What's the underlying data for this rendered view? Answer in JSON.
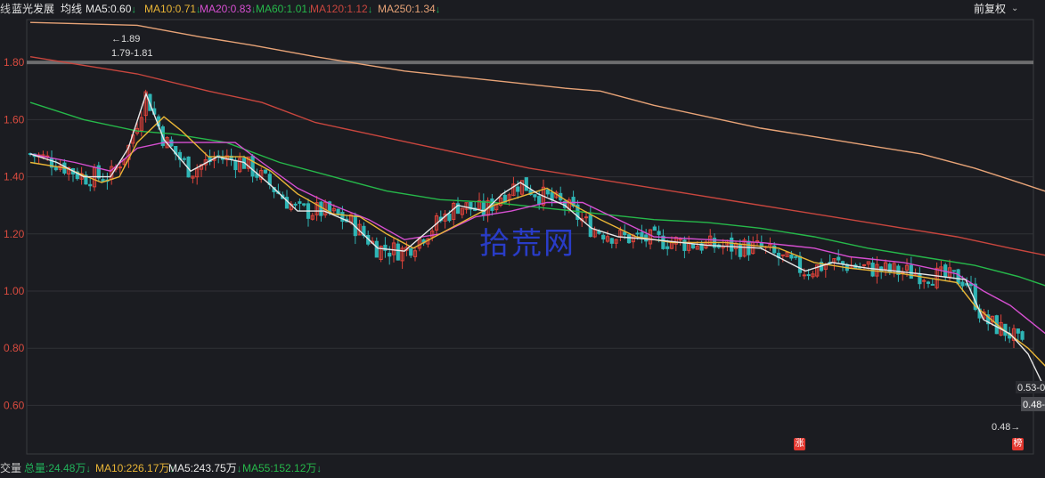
{
  "header": {
    "left_cut": "线",
    "stock_name": "蓝光发展",
    "mode": "均线",
    "ma_values": [
      {
        "label": "MA5:0.60",
        "color": "#e8e8e8"
      },
      {
        "label": "MA10:0.71",
        "color": "#e9b536"
      },
      {
        "label": "MA20:0.83",
        "color": "#d64fd1"
      },
      {
        "label": "MA60:1.01",
        "color": "#26b84a"
      },
      {
        "label": "MA120:1.12",
        "color": "#c8463e"
      },
      {
        "label": "MA250:1.34",
        "color": "#e7a377"
      }
    ],
    "down_arrow": "↓",
    "adjust_label": "前复权"
  },
  "volume_bar": {
    "left_cut": "交量",
    "items": [
      {
        "label": "总量:24.48万",
        "color": "#21b35b"
      },
      {
        "label": "MA10:226.17万",
        "color": "#e9b536"
      },
      {
        "label": "MA5:243.75万",
        "color": "#e8e8e8"
      },
      {
        "label": "MA55:152.12万",
        "color": "#26b84a"
      }
    ]
  },
  "watermark": "拾荒网",
  "badges": {
    "limit_up": "涨",
    "rank": "榜"
  },
  "chart_data": {
    "type": "line",
    "ylim": [
      0.43,
      1.95
    ],
    "y_ticks": [
      "0.60",
      "0.80",
      "1.00",
      "1.20",
      "1.40",
      "1.60",
      "1.80"
    ],
    "grid": true,
    "reference_line": 1.8,
    "annotations": {
      "high_mark": "1.89",
      "high_range": "1.79-1.81",
      "last_range": "0.53-0",
      "last_price_tag": "0.48-",
      "low_mark": "0.48"
    },
    "series": [
      {
        "name": "MA250",
        "color": "#e7a377",
        "x": [
          0,
          120,
          190,
          250,
          320,
          380,
          420,
          480,
          540,
          600,
          640,
          700,
          760,
          820,
          880,
          940,
          1000,
          1060,
          1100,
          1148
        ],
        "y": [
          1.94,
          1.93,
          1.89,
          1.86,
          1.82,
          1.79,
          1.77,
          1.75,
          1.73,
          1.71,
          1.7,
          1.65,
          1.61,
          1.57,
          1.54,
          1.51,
          1.48,
          1.43,
          1.39,
          1.34
        ]
      },
      {
        "name": "MA120",
        "color": "#c8463e",
        "x": [
          0,
          60,
          120,
          200,
          260,
          320,
          380,
          440,
          500,
          560,
          620,
          680,
          740,
          800,
          860,
          920,
          980,
          1040,
          1100,
          1148
        ],
        "y": [
          1.82,
          1.79,
          1.76,
          1.7,
          1.66,
          1.59,
          1.55,
          1.51,
          1.47,
          1.43,
          1.4,
          1.37,
          1.34,
          1.31,
          1.28,
          1.25,
          1.22,
          1.19,
          1.15,
          1.12
        ]
      },
      {
        "name": "MA60",
        "color": "#26b84a",
        "x": [
          0,
          60,
          120,
          160,
          220,
          280,
          340,
          400,
          460,
          520,
          580,
          640,
          700,
          760,
          820,
          880,
          940,
          1000,
          1060,
          1110,
          1148
        ],
        "y": [
          1.66,
          1.6,
          1.56,
          1.55,
          1.52,
          1.45,
          1.4,
          1.35,
          1.32,
          1.31,
          1.29,
          1.27,
          1.25,
          1.24,
          1.22,
          1.19,
          1.15,
          1.12,
          1.09,
          1.05,
          1.01
        ]
      },
      {
        "name": "MA20",
        "color": "#d64fd1",
        "x": [
          0,
          50,
          90,
          120,
          150,
          190,
          230,
          260,
          300,
          340,
          380,
          420,
          460,
          500,
          540,
          580,
          620,
          660,
          700,
          760,
          820,
          880,
          920,
          980,
          1040,
          1070,
          1100,
          1148
        ],
        "y": [
          1.48,
          1.45,
          1.42,
          1.5,
          1.52,
          1.52,
          1.52,
          1.45,
          1.36,
          1.3,
          1.25,
          1.18,
          1.2,
          1.26,
          1.28,
          1.31,
          1.31,
          1.25,
          1.19,
          1.18,
          1.17,
          1.15,
          1.12,
          1.1,
          1.06,
          1.0,
          0.95,
          0.83
        ]
      },
      {
        "name": "MA10",
        "color": "#e9b536",
        "x": [
          0,
          40,
          80,
          100,
          120,
          150,
          170,
          200,
          240,
          270,
          300,
          340,
          370,
          400,
          430,
          460,
          490,
          520,
          550,
          580,
          610,
          640,
          680,
          720,
          780,
          840,
          880,
          920,
          980,
          1040,
          1060,
          1090,
          1120,
          1148
        ],
        "y": [
          1.45,
          1.43,
          1.38,
          1.4,
          1.52,
          1.61,
          1.56,
          1.47,
          1.47,
          1.42,
          1.34,
          1.27,
          1.26,
          1.2,
          1.15,
          1.2,
          1.25,
          1.3,
          1.33,
          1.36,
          1.3,
          1.25,
          1.19,
          1.17,
          1.17,
          1.15,
          1.1,
          1.08,
          1.06,
          1.03,
          0.95,
          0.87,
          0.8,
          0.71
        ]
      },
      {
        "name": "MA5",
        "color": "#e8e8e8",
        "x": [
          0,
          30,
          60,
          90,
          110,
          130,
          150,
          180,
          210,
          240,
          270,
          300,
          330,
          360,
          390,
          420,
          450,
          480,
          510,
          530,
          550,
          570,
          600,
          630,
          660,
          700,
          760,
          820,
          870,
          900,
          940,
          1000,
          1050,
          1070,
          1100,
          1120,
          1148
        ],
        "y": [
          1.48,
          1.45,
          1.4,
          1.4,
          1.5,
          1.69,
          1.53,
          1.42,
          1.47,
          1.45,
          1.37,
          1.28,
          1.28,
          1.24,
          1.15,
          1.14,
          1.22,
          1.3,
          1.28,
          1.34,
          1.38,
          1.34,
          1.3,
          1.22,
          1.19,
          1.18,
          1.16,
          1.15,
          1.07,
          1.1,
          1.08,
          1.06,
          1.04,
          0.9,
          0.85,
          0.78,
          0.6
        ]
      }
    ]
  }
}
